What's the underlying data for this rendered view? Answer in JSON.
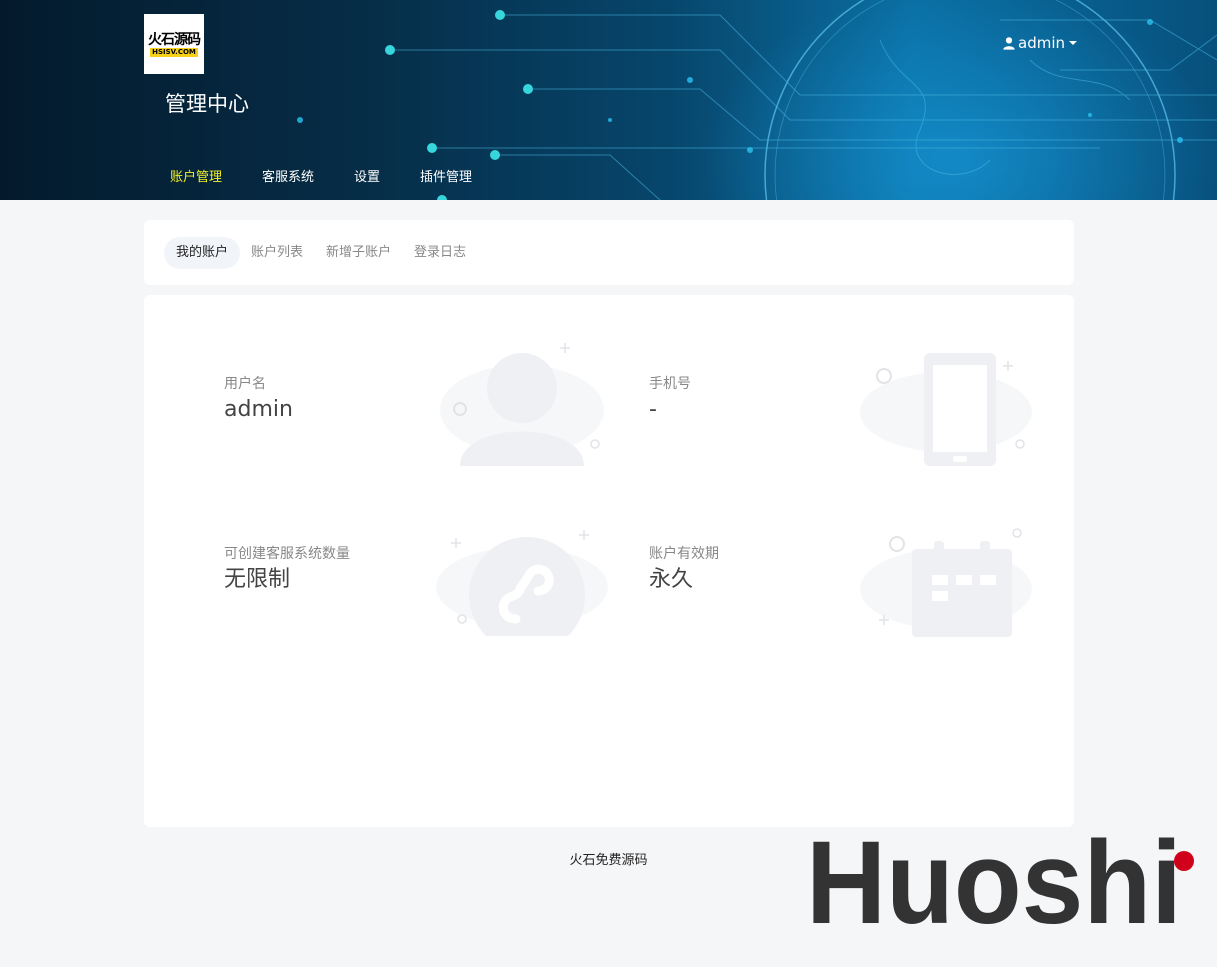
{
  "header": {
    "logo": {
      "line1": "火石源码",
      "line2": "HSISV.COM"
    },
    "title": "管理中心",
    "user": {
      "name": "admin",
      "icon": "user-icon"
    },
    "nav": [
      {
        "label": "账户管理",
        "active": true
      },
      {
        "label": "客服系统",
        "active": false
      },
      {
        "label": "设置",
        "active": false
      },
      {
        "label": "插件管理",
        "active": false
      }
    ]
  },
  "tabs": [
    {
      "label": "我的账户",
      "active": true
    },
    {
      "label": "账户列表",
      "active": false
    },
    {
      "label": "新增子账户",
      "active": false
    },
    {
      "label": "登录日志",
      "active": false
    }
  ],
  "account": {
    "username": {
      "label": "用户名",
      "value": "admin",
      "icon": "user-icon"
    },
    "phone": {
      "label": "手机号",
      "value": "-",
      "icon": "phone-icon"
    },
    "quota": {
      "label": "可创建客服系统数量",
      "value": "无限制",
      "icon": "mini-program-icon"
    },
    "validity": {
      "label": "账户有效期",
      "value": "永久",
      "icon": "calendar-icon"
    }
  },
  "footer": {
    "text": "火石免费源码"
  },
  "watermark": {
    "text": "Huoshi"
  },
  "colors": {
    "nav_active": "#f3f12a",
    "illustration": "#eff0f3",
    "watermark": "#333333",
    "watermark_dot": "#d0021b"
  }
}
